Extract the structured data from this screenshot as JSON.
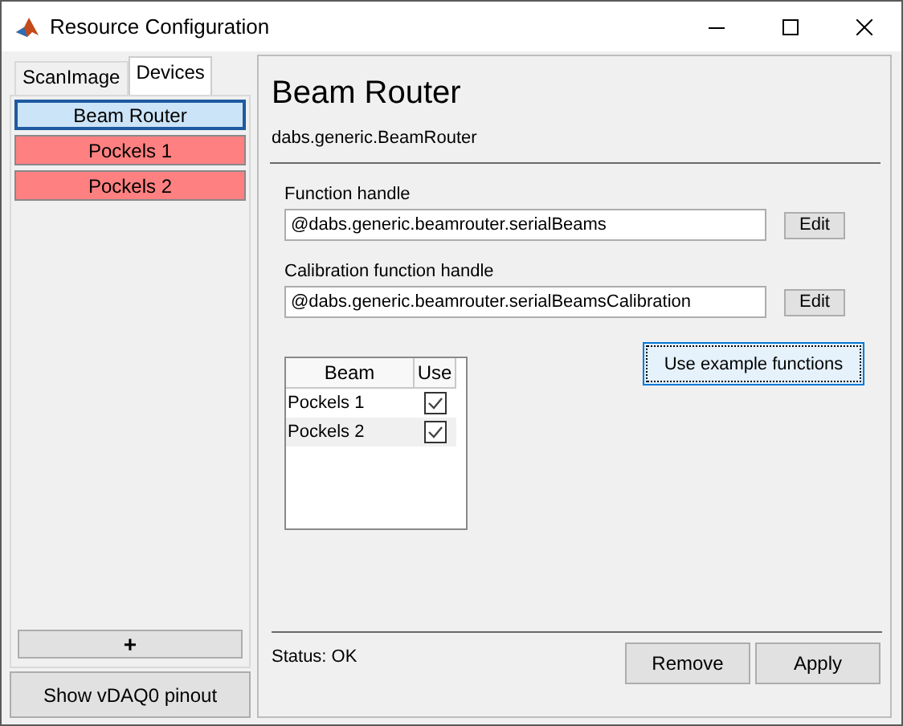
{
  "window": {
    "title": "Resource Configuration"
  },
  "tabs": [
    {
      "label": "ScanImage",
      "selected": false
    },
    {
      "label": "Devices",
      "selected": true
    }
  ],
  "devices": [
    {
      "label": "Beam Router",
      "selected": true,
      "color": "#cce4f7"
    },
    {
      "label": "Pockels 1",
      "selected": false,
      "color": "#ff8080"
    },
    {
      "label": "Pockels 2",
      "selected": false,
      "color": "#ff8080"
    }
  ],
  "add_button": "+",
  "pinout_button": "Show vDAQ0 pinout",
  "panel": {
    "title": "Beam Router",
    "class_name": "dabs.generic.BeamRouter",
    "fields": [
      {
        "label": "Function handle",
        "value": "@dabs.generic.beamrouter.serialBeams",
        "button": "Edit"
      },
      {
        "label": "Calibration function handle",
        "value": "@dabs.generic.beamrouter.serialBeamsCalibration",
        "button": "Edit"
      }
    ],
    "example_button": "Use example functions",
    "table": {
      "columns": [
        "Beam",
        "Use"
      ],
      "rows": [
        {
          "beam": "Pockels 1",
          "use": true
        },
        {
          "beam": "Pockels 2",
          "use": true
        }
      ]
    },
    "status": "Status: OK",
    "buttons": [
      "Remove",
      "Apply"
    ]
  }
}
